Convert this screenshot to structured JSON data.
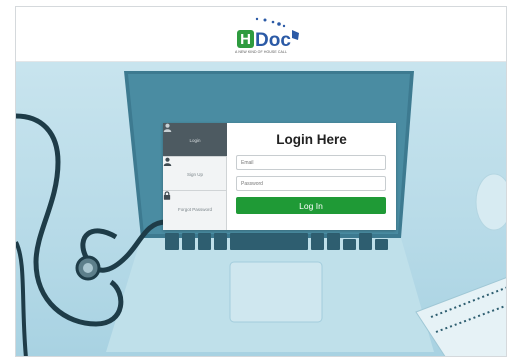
{
  "header": {
    "logo_letter": "H",
    "logo_text": "Doc",
    "tagline": "A NEW KIND OF HOUSE CALL",
    "brand_colors": {
      "blue": "#2b5aa6",
      "green": "#2e9b3f"
    }
  },
  "tabs": [
    {
      "label": "Login",
      "icon": "user-icon",
      "glyph": "●",
      "active": true
    },
    {
      "label": "Sign Up",
      "icon": "user-add-icon",
      "glyph": "●",
      "active": false
    },
    {
      "label": "Forgot Password",
      "icon": "lock-icon",
      "glyph": "🔒",
      "active": false
    }
  ],
  "form": {
    "title": "Login Here",
    "email_placeholder": "Email",
    "email_value": "",
    "password_placeholder": "Password",
    "password_value": "",
    "submit_label": "Log In"
  },
  "colors": {
    "submit_button": "#1f9a36",
    "active_tab": "#4d5a61",
    "hero_tint": "#b8dbe8"
  }
}
